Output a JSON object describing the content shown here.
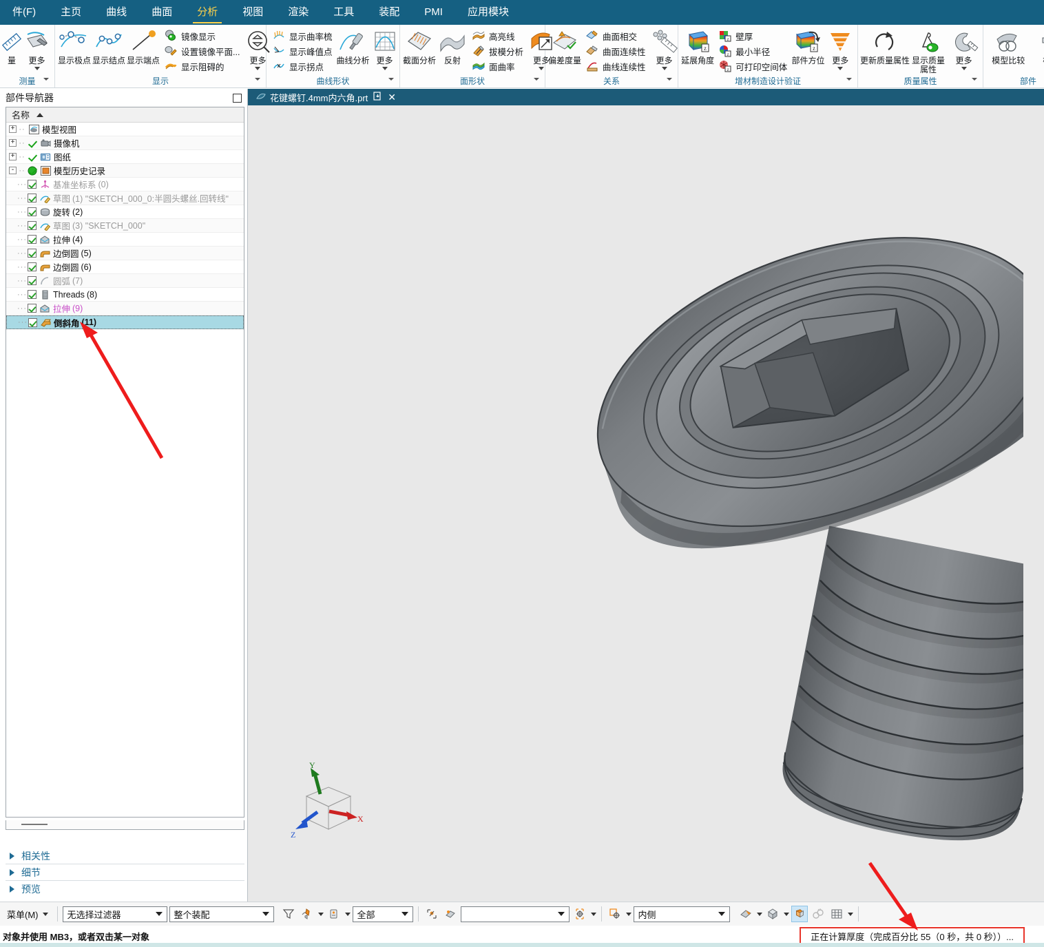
{
  "window": {
    "title_tabs": [
      {
        "label": "件(F)",
        "active": false
      },
      {
        "label": "主页",
        "active": false
      },
      {
        "label": "曲线",
        "active": false
      },
      {
        "label": "曲面",
        "active": false
      },
      {
        "label": "分析",
        "active": true
      },
      {
        "label": "视图",
        "active": false
      },
      {
        "label": "渲染",
        "active": false
      },
      {
        "label": "工具",
        "active": false
      },
      {
        "label": "装配",
        "active": false
      },
      {
        "label": "PMI",
        "active": false
      },
      {
        "label": "应用模块",
        "active": false
      }
    ],
    "accent_color": "#156082",
    "active_tab_color": "#ffd24a"
  },
  "ribbon": {
    "groups": [
      {
        "title": "测量",
        "big": [
          {
            "label": "量",
            "icon": "ruler-icon",
            "caret": false
          },
          {
            "label": "更多",
            "icon": "measure-more-icon",
            "caret": true
          }
        ],
        "small": []
      },
      {
        "title": "显示",
        "big": [
          {
            "label": "显示极点",
            "icon": "show-poles-icon",
            "caret": false
          },
          {
            "label": "显示结点",
            "icon": "show-knots-icon",
            "caret": false
          },
          {
            "label": "显示端点",
            "icon": "show-endpoints-icon",
            "caret": false
          }
        ],
        "small": [
          {
            "label": "镜像显示",
            "icon": "mirror-display-icon"
          },
          {
            "label": "设置镜像平面...",
            "icon": "set-mirror-plane-icon"
          },
          {
            "label": "显示阻碍的",
            "icon": "show-obstructed-icon"
          }
        ],
        "big_after": [
          {
            "label": "更多",
            "icon": "display-more-icon",
            "caret": true
          }
        ]
      },
      {
        "title": "曲线形状",
        "small": [
          {
            "label": "显示曲率梳",
            "icon": "curvature-comb-icon"
          },
          {
            "label": "显示峰值点",
            "icon": "peak-points-icon"
          },
          {
            "label": "显示拐点",
            "icon": "inflection-points-icon"
          }
        ],
        "big_after": [
          {
            "label": "曲线分析",
            "icon": "curve-analysis-icon",
            "caret": false
          },
          {
            "label": "更多",
            "icon": "curve-more-icon",
            "caret": true
          }
        ]
      },
      {
        "title": "面形状",
        "big": [
          {
            "label": "截面分析",
            "icon": "section-analysis-icon",
            "caret": false
          },
          {
            "label": "反射",
            "icon": "reflection-icon",
            "caret": false
          }
        ],
        "small": [
          {
            "label": "高亮线",
            "icon": "highlight-lines-icon"
          },
          {
            "label": "拔模分析",
            "icon": "draft-analysis-icon"
          },
          {
            "label": "面曲率",
            "icon": "face-curvature-icon"
          }
        ],
        "big_after": [
          {
            "label": "更多",
            "icon": "face-more-icon",
            "caret": true
          }
        ]
      },
      {
        "title": "关系",
        "big": [
          {
            "label": "偏差度量",
            "icon": "deviation-gauge-icon",
            "caret": false
          }
        ],
        "small": [
          {
            "label": "曲面相交",
            "icon": "surface-intersect-icon"
          },
          {
            "label": "曲面连续性",
            "icon": "surface-continuity-icon"
          },
          {
            "label": "曲线连续性",
            "icon": "curve-continuity-icon"
          }
        ],
        "big_after": [
          {
            "label": "更多",
            "icon": "relations-more-icon",
            "caret": true
          }
        ]
      },
      {
        "title": "增材制造设计验证",
        "big": [
          {
            "label": "延展角度",
            "icon": "overhang-angle-icon",
            "caret": false
          }
        ],
        "small": [
          {
            "label": "壁厚",
            "icon": "wall-thickness-icon"
          },
          {
            "label": "最小半径",
            "icon": "min-radius-icon"
          },
          {
            "label": "可打印空间体",
            "icon": "printable-volume-icon"
          }
        ],
        "big_after": [
          {
            "label": "部件方位",
            "icon": "part-orientation-icon",
            "caret": false
          },
          {
            "label": "更多",
            "icon": "am-more-icon",
            "caret": true
          }
        ]
      },
      {
        "title": "质量属性",
        "big": [
          {
            "label": "更新质量属性",
            "icon": "update-mass-props-icon",
            "caret": false
          },
          {
            "label": "显示质量属性",
            "icon": "show-mass-props-icon",
            "caret": false
          },
          {
            "label": "更多",
            "icon": "mass-more-icon",
            "caret": true
          }
        ],
        "small": []
      },
      {
        "title": "部件",
        "big": [
          {
            "label": "模型比较",
            "icon": "model-compare-icon",
            "caret": false
          },
          {
            "label": "检查",
            "icon": "examine-icon",
            "caret": false
          }
        ],
        "small": []
      }
    ]
  },
  "navigator": {
    "title": "部件导航器",
    "column_header": "名称",
    "tree": [
      {
        "expander": "+",
        "mark": "none",
        "icon": "model-views-icon",
        "label": "模型视图",
        "num": "",
        "dim": false,
        "depth": 0
      },
      {
        "expander": "+",
        "mark": "check",
        "icon": "camera-icon",
        "label": "摄像机",
        "num": "",
        "dim": false,
        "depth": 0
      },
      {
        "expander": "+",
        "mark": "check",
        "icon": "drawing-icon",
        "label": "图纸",
        "num": "",
        "dim": false,
        "depth": 0
      },
      {
        "expander": "-",
        "mark": "green-dot",
        "icon": "history-icon",
        "label": "模型历史记录",
        "num": "",
        "dim": false,
        "depth": 0
      },
      {
        "expander": "",
        "mark": "checkbox",
        "icon": "datum-csys-icon",
        "label": "基准坐标系",
        "num": "(0)",
        "dim": true,
        "depth": 1
      },
      {
        "expander": "",
        "mark": "checkbox",
        "icon": "sketch-icon",
        "label": "草图",
        "num": "(1) \"SKETCH_000_0:半圆头螺丝.回转线\"",
        "dim": true,
        "depth": 1
      },
      {
        "expander": "",
        "mark": "checkbox",
        "icon": "revolve-icon",
        "label": "旋转",
        "num": "(2)",
        "dim": false,
        "depth": 1
      },
      {
        "expander": "",
        "mark": "checkbox",
        "icon": "sketch-icon",
        "label": "草图",
        "num": "(3) \"SKETCH_000\"",
        "dim": true,
        "depth": 1
      },
      {
        "expander": "",
        "mark": "checkbox",
        "icon": "extrude-icon",
        "label": "拉伸",
        "num": "(4)",
        "dim": false,
        "depth": 1
      },
      {
        "expander": "",
        "mark": "checkbox",
        "icon": "edge-blend-icon",
        "label": "边倒圆",
        "num": "(5)",
        "dim": false,
        "depth": 1
      },
      {
        "expander": "",
        "mark": "checkbox",
        "icon": "edge-blend-icon",
        "label": "边倒圆",
        "num": "(6)",
        "dim": false,
        "depth": 1
      },
      {
        "expander": "",
        "mark": "checkbox",
        "icon": "arc-icon",
        "label": "圆弧",
        "num": "(7)",
        "dim": true,
        "depth": 1
      },
      {
        "expander": "",
        "mark": "checkbox",
        "icon": "threads-icon",
        "label": "Threads",
        "num": "(8)",
        "dim": false,
        "depth": 1
      },
      {
        "expander": "",
        "mark": "checkbox",
        "icon": "extrude-icon",
        "label": "拉伸",
        "num": "(9)",
        "dim": false,
        "pink": true,
        "depth": 1
      },
      {
        "expander": "",
        "mark": "checkbox",
        "icon": "chamfer-icon",
        "label": "倒斜角",
        "num": "(11)",
        "dim": false,
        "selected": true,
        "bold": true,
        "depth": 1
      }
    ],
    "sections": [
      {
        "label": "相关性"
      },
      {
        "label": "细节"
      },
      {
        "label": "预览"
      }
    ]
  },
  "document": {
    "tab_label": "花键螺钉.4mm内六角.prt",
    "modified_marker": "⭳",
    "close_marker": "✕"
  },
  "viewport": {
    "background_color": "#e8e8e8",
    "model_name": "button-head-hex-socket-screw",
    "triad_axes": [
      {
        "label": "X",
        "color": "#cc2222"
      },
      {
        "label": "Y",
        "color": "#1e7a1e"
      },
      {
        "label": "Z",
        "color": "#2255cc"
      }
    ]
  },
  "selection_bar": {
    "menu_label": "菜单(M)",
    "filter_value": "无选择过滤器",
    "scope_value": "整个装配",
    "all_value": "全部",
    "empty_value": "",
    "side_value": "内侧"
  },
  "status": {
    "hint_text": "对象并使用 MB3，或者双击某一对象",
    "progress_message": "正在计算厚度（完成百分比 55（0 秒，共 0 秒））...",
    "progress_percent": 55,
    "highlight_border_color": "#e8342a"
  },
  "annotations": {
    "arrow_color": "#ee1c1c",
    "arrows": [
      {
        "name": "arrow-to-chamfer-node"
      },
      {
        "name": "arrow-to-status-message"
      }
    ]
  }
}
